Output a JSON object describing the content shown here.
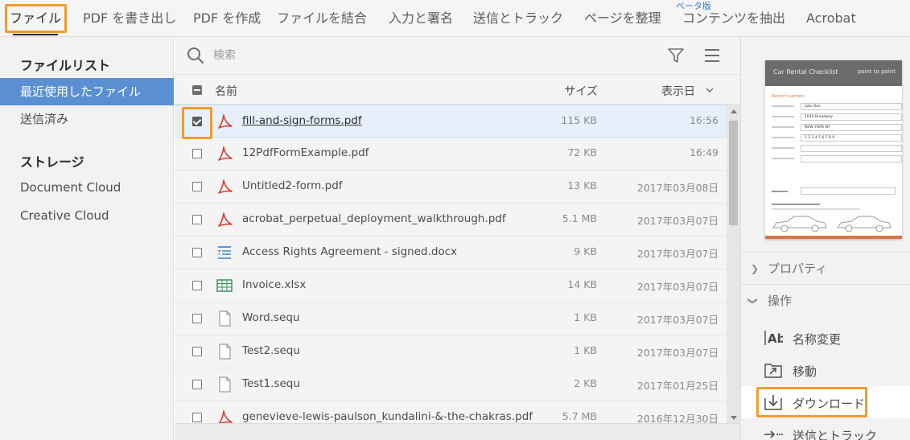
{
  "menu": {
    "items": [
      {
        "id": "file",
        "label": "ファイル",
        "active": true
      },
      {
        "id": "export-pdf",
        "label": "PDF を書き出し"
      },
      {
        "id": "create-pdf",
        "label": "PDF を作成"
      },
      {
        "id": "combine",
        "label": "ファイルを結合"
      },
      {
        "id": "fill-sign",
        "label": "入力と署名"
      },
      {
        "id": "send-track",
        "label": "送信とトラック"
      },
      {
        "id": "organize",
        "label": "ページを整理"
      },
      {
        "id": "extract",
        "label": "コンテンツを抽出"
      },
      {
        "id": "acrobat",
        "label": "Acrobat"
      }
    ],
    "beta_badge": "ベータ版"
  },
  "sidebar": {
    "file_list_heading": "ファイルリスト",
    "file_list_items": [
      {
        "label": "最近使用したファイル",
        "selected": true
      },
      {
        "label": "送信済み"
      }
    ],
    "storage_heading": "ストレージ",
    "storage_items": [
      {
        "label": "Document Cloud"
      },
      {
        "label": "Creative Cloud"
      }
    ]
  },
  "search": {
    "placeholder": "検索",
    "value": ""
  },
  "table": {
    "columns": {
      "name": "名前",
      "size": "サイズ",
      "date": "表示日"
    },
    "rows": [
      {
        "name": "fill-and-sign-forms.pdf",
        "size": "115 KB",
        "date": "16:56",
        "type": "pdf",
        "checked": true,
        "selected": true
      },
      {
        "name": "12PdfFormExample.pdf",
        "size": "72 KB",
        "date": "16:49",
        "type": "pdf",
        "checked": false
      },
      {
        "name": "Untitled2-form.pdf",
        "size": "13 KB",
        "date": "2017年03月08日",
        "type": "pdf",
        "checked": false
      },
      {
        "name": "acrobat_perpetual_deployment_walkthrough.pdf",
        "size": "5.1 MB",
        "date": "2017年03月07日",
        "type": "pdf",
        "checked": false
      },
      {
        "name": "Access Rights Agreement - signed.docx",
        "size": "9 KB",
        "date": "2017年03月07日",
        "type": "docx",
        "checked": false
      },
      {
        "name": "Invoice.xlsx",
        "size": "14 KB",
        "date": "2017年03月07日",
        "type": "xlsx",
        "checked": false
      },
      {
        "name": "Word.sequ",
        "size": "1 KB",
        "date": "2017年03月07日",
        "type": "generic",
        "checked": false
      },
      {
        "name": "Test2.sequ",
        "size": "1 KB",
        "date": "2017年03月07日",
        "type": "generic",
        "checked": false
      },
      {
        "name": "Test1.sequ",
        "size": "2 KB",
        "date": "2017年01月25日",
        "type": "generic",
        "checked": false
      },
      {
        "name": "genevieve-lewis-paulson_kundalini-&-the-chakras.pdf",
        "size": "5.7 MB",
        "date": "2016年12月30日",
        "type": "pdf",
        "checked": false
      }
    ]
  },
  "preview": {
    "title": "Car Rental Checklist",
    "brand": "point to point",
    "section": "Renter's section",
    "fields": [
      "Jobs Doe",
      "1640 Broadway",
      "NEW YORK      NY",
      "1 2 3 4 5 6 7 8 9",
      "",
      ""
    ]
  },
  "right_panel": {
    "properties_label": "プロパティ",
    "actions_label": "操作",
    "actions": [
      {
        "id": "rename",
        "label": "名称変更",
        "icon": "rename-icon"
      },
      {
        "id": "move",
        "label": "移動",
        "icon": "move-icon"
      },
      {
        "id": "download",
        "label": "ダウンロード",
        "icon": "download-icon",
        "highlighted": true
      },
      {
        "id": "send-track",
        "label": "送信とトラック",
        "icon": "send-track-icon"
      }
    ]
  },
  "colors": {
    "highlight": "#f39b2b",
    "selected_sidebar": "#5a8fd1",
    "pdf_icon": "#d83b2f",
    "xlsx_icon": "#2e8b57",
    "docx_icon": "#2d7dd2",
    "beta": "#2d7dd2"
  }
}
